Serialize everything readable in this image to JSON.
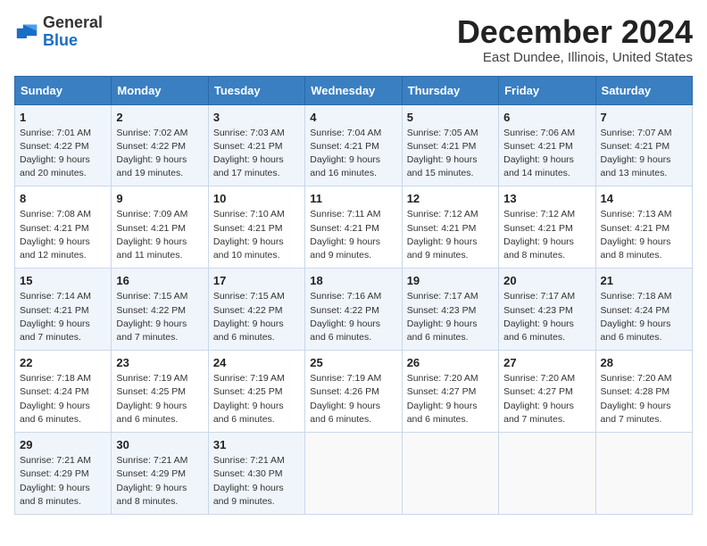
{
  "logo": {
    "general": "General",
    "blue": "Blue"
  },
  "title": "December 2024",
  "subtitle": "East Dundee, Illinois, United States",
  "header": {
    "days": [
      "Sunday",
      "Monday",
      "Tuesday",
      "Wednesday",
      "Thursday",
      "Friday",
      "Saturday"
    ]
  },
  "weeks": [
    [
      {
        "day": "1",
        "info": "Sunrise: 7:01 AM\nSunset: 4:22 PM\nDaylight: 9 hours and 20 minutes."
      },
      {
        "day": "2",
        "info": "Sunrise: 7:02 AM\nSunset: 4:22 PM\nDaylight: 9 hours and 19 minutes."
      },
      {
        "day": "3",
        "info": "Sunrise: 7:03 AM\nSunset: 4:21 PM\nDaylight: 9 hours and 17 minutes."
      },
      {
        "day": "4",
        "info": "Sunrise: 7:04 AM\nSunset: 4:21 PM\nDaylight: 9 hours and 16 minutes."
      },
      {
        "day": "5",
        "info": "Sunrise: 7:05 AM\nSunset: 4:21 PM\nDaylight: 9 hours and 15 minutes."
      },
      {
        "day": "6",
        "info": "Sunrise: 7:06 AM\nSunset: 4:21 PM\nDaylight: 9 hours and 14 minutes."
      },
      {
        "day": "7",
        "info": "Sunrise: 7:07 AM\nSunset: 4:21 PM\nDaylight: 9 hours and 13 minutes."
      }
    ],
    [
      {
        "day": "8",
        "info": "Sunrise: 7:08 AM\nSunset: 4:21 PM\nDaylight: 9 hours and 12 minutes."
      },
      {
        "day": "9",
        "info": "Sunrise: 7:09 AM\nSunset: 4:21 PM\nDaylight: 9 hours and 11 minutes."
      },
      {
        "day": "10",
        "info": "Sunrise: 7:10 AM\nSunset: 4:21 PM\nDaylight: 9 hours and 10 minutes."
      },
      {
        "day": "11",
        "info": "Sunrise: 7:11 AM\nSunset: 4:21 PM\nDaylight: 9 hours and 9 minutes."
      },
      {
        "day": "12",
        "info": "Sunrise: 7:12 AM\nSunset: 4:21 PM\nDaylight: 9 hours and 9 minutes."
      },
      {
        "day": "13",
        "info": "Sunrise: 7:12 AM\nSunset: 4:21 PM\nDaylight: 9 hours and 8 minutes."
      },
      {
        "day": "14",
        "info": "Sunrise: 7:13 AM\nSunset: 4:21 PM\nDaylight: 9 hours and 8 minutes."
      }
    ],
    [
      {
        "day": "15",
        "info": "Sunrise: 7:14 AM\nSunset: 4:21 PM\nDaylight: 9 hours and 7 minutes."
      },
      {
        "day": "16",
        "info": "Sunrise: 7:15 AM\nSunset: 4:22 PM\nDaylight: 9 hours and 7 minutes."
      },
      {
        "day": "17",
        "info": "Sunrise: 7:15 AM\nSunset: 4:22 PM\nDaylight: 9 hours and 6 minutes."
      },
      {
        "day": "18",
        "info": "Sunrise: 7:16 AM\nSunset: 4:22 PM\nDaylight: 9 hours and 6 minutes."
      },
      {
        "day": "19",
        "info": "Sunrise: 7:17 AM\nSunset: 4:23 PM\nDaylight: 9 hours and 6 minutes."
      },
      {
        "day": "20",
        "info": "Sunrise: 7:17 AM\nSunset: 4:23 PM\nDaylight: 9 hours and 6 minutes."
      },
      {
        "day": "21",
        "info": "Sunrise: 7:18 AM\nSunset: 4:24 PM\nDaylight: 9 hours and 6 minutes."
      }
    ],
    [
      {
        "day": "22",
        "info": "Sunrise: 7:18 AM\nSunset: 4:24 PM\nDaylight: 9 hours and 6 minutes."
      },
      {
        "day": "23",
        "info": "Sunrise: 7:19 AM\nSunset: 4:25 PM\nDaylight: 9 hours and 6 minutes."
      },
      {
        "day": "24",
        "info": "Sunrise: 7:19 AM\nSunset: 4:25 PM\nDaylight: 9 hours and 6 minutes."
      },
      {
        "day": "25",
        "info": "Sunrise: 7:19 AM\nSunset: 4:26 PM\nDaylight: 9 hours and 6 minutes."
      },
      {
        "day": "26",
        "info": "Sunrise: 7:20 AM\nSunset: 4:27 PM\nDaylight: 9 hours and 6 minutes."
      },
      {
        "day": "27",
        "info": "Sunrise: 7:20 AM\nSunset: 4:27 PM\nDaylight: 9 hours and 7 minutes."
      },
      {
        "day": "28",
        "info": "Sunrise: 7:20 AM\nSunset: 4:28 PM\nDaylight: 9 hours and 7 minutes."
      }
    ],
    [
      {
        "day": "29",
        "info": "Sunrise: 7:21 AM\nSunset: 4:29 PM\nDaylight: 9 hours and 8 minutes."
      },
      {
        "day": "30",
        "info": "Sunrise: 7:21 AM\nSunset: 4:29 PM\nDaylight: 9 hours and 8 minutes."
      },
      {
        "day": "31",
        "info": "Sunrise: 7:21 AM\nSunset: 4:30 PM\nDaylight: 9 hours and 9 minutes."
      },
      null,
      null,
      null,
      null
    ]
  ]
}
